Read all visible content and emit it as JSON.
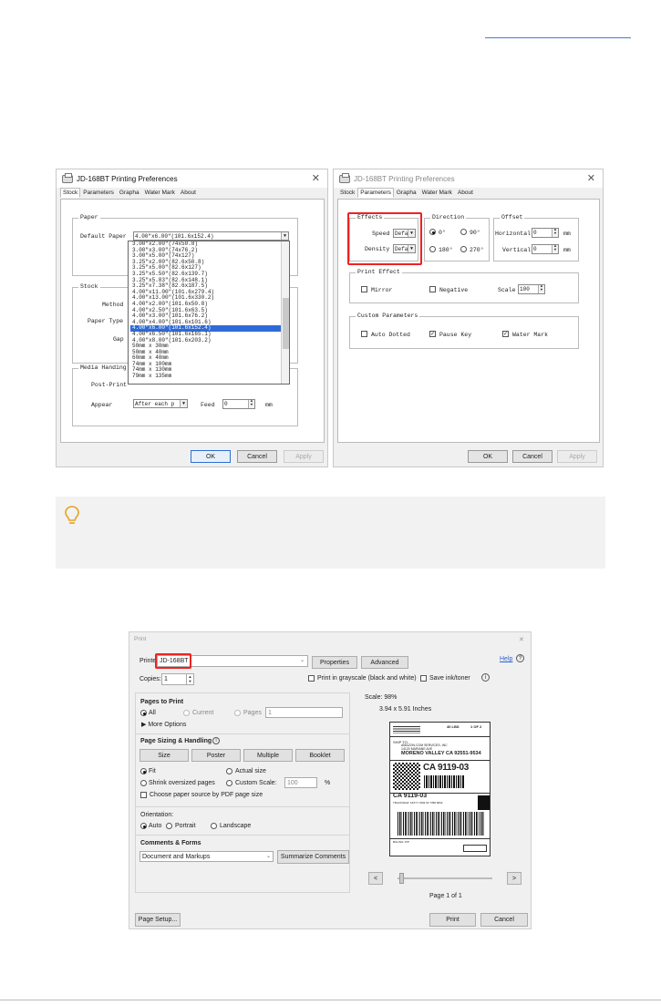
{
  "top_link": "",
  "stock_dialog": {
    "title": "JD-168BT Printing Preferences",
    "close": "✕",
    "tabs": [
      "Stock",
      "Parameters",
      "Grapha",
      "Water Mark",
      "About"
    ],
    "active_tab": "Stock",
    "paper_group": "Paper",
    "default_paper_label": "Default Paper",
    "default_paper_value": "4.00\"x6.00\"(101.6x152.4)",
    "paper_options": [
      "3.00\"x2.00\"(74x50.8)",
      "3.00\"x3.00\"(74x76.2)",
      "3.00\"x5.00\"(74x127)",
      "3.25\"x2.00\"(82.6x50.8)",
      "3.25\"x5.00\"(82.6x127)",
      "3.25\"x5.50\"(82.6x139.7)",
      "3.25\"x5.83\"(82.6x148.1)",
      "3.25\"x7.38\"(82.6x187.5)",
      "4.00\"x11.00\"(101.6x279.4)",
      "4.00\"x13.00\"(101.6x330.2)",
      "4.00\"x2.00\"(101.6x50.8)",
      "4.00\"x2.50\"(101.6x63.5)",
      "4.00\"x3.00\"(101.6x76.2)",
      "4.00\"x4.00\"(101.6x101.6)",
      "4.00\"x6.00\"(101.6x152.4)",
      "4.00\"x6.50\"(101.6x165.1)",
      "4.00\"x8.00\"(101.6x203.2)",
      "50mm x 30mm",
      "50mm x 40mm",
      "60mm x 40mm",
      "74mm x 100mm",
      "74mm x 130mm",
      "79mm x 135mm"
    ],
    "highlighted_option": 14,
    "stock_group": "Stock",
    "method_label": "Method",
    "paper_type_label": "Paper Type",
    "gap_label": "Gap",
    "media_group": "Media Handing",
    "post_print_label": "Post-Print",
    "appear_label": "Appear",
    "appear_value": "After each p",
    "feed_label": "Feed",
    "feed_value": "0",
    "feed_unit": "mm",
    "ok": "OK",
    "cancel": "Cancel",
    "apply": "Apply"
  },
  "param_dialog": {
    "title": "JD-168BT Printing Preferences",
    "close": "✕",
    "tabs": [
      "Stock",
      "Parameters",
      "Grapha",
      "Water Mark",
      "About"
    ],
    "active_tab": "Parameters",
    "effects_group": "Effects",
    "speed_label": "Speed",
    "speed_value": "Defa",
    "density_label": "Density",
    "density_value": "Defa",
    "direction_group": "Direction",
    "dir_0": "0°",
    "dir_90": "90°",
    "dir_180": "180°",
    "dir_270": "270°",
    "offset_group": "Offset",
    "horizontal_label": "Horizontal",
    "horizontal_value": "0",
    "vertical_label": "Vertical",
    "vertical_value": "0",
    "unit": "mm",
    "print_effect_group": "Print Effect",
    "mirror": "Mirror",
    "negative": "Negative",
    "scale_label": "Scale",
    "scale_value": "100",
    "custom_group": "Custom Parameters",
    "auto_dotted": "Auto Dotted",
    "pause_key": "Pause Key",
    "water_mark": "Water Mark",
    "ok": "OK",
    "cancel": "Cancel",
    "apply": "Apply"
  },
  "note_icon": "lightbulb-icon",
  "print_dialog": {
    "title": "Print",
    "close": "✕",
    "printer_label": "Printer:",
    "printer_value": "JD-168BT",
    "properties": "Properties",
    "advanced": "Advanced",
    "help": "Help",
    "copies_label": "Copies:",
    "copies_value": "1",
    "grayscale": "Print in grayscale (black and white)",
    "save_ink": "Save ink/toner",
    "pages_to_print": "Pages to Print",
    "all": "All",
    "current": "Current",
    "pages": "Pages",
    "pages_value": "1",
    "more_options": "More Options",
    "sizing_title": "Page Sizing & Handling",
    "size_btn": "Size",
    "poster_btn": "Poster",
    "multiple_btn": "Multiple",
    "booklet_btn": "Booklet",
    "fit": "Fit",
    "actual_size": "Actual size",
    "shrink": "Shrink oversized pages",
    "custom_scale": "Custom Scale:",
    "custom_scale_value": "100",
    "percent": "%",
    "choose_paper": "Choose paper source by PDF page size",
    "orientation": "Orientation:",
    "auto": "Auto",
    "portrait": "Portrait",
    "landscape": "Landscape",
    "comments_title": "Comments & Forms",
    "comments_value": "Document and Markups",
    "summarize": "Summarize Comments",
    "scale": "Scale: 98%",
    "dimensions": "3.94 x 5.91 Inches",
    "page_of": "Page 1 of 1",
    "page_setup": "Page Setup...",
    "print": "Print",
    "cancel": "Cancel",
    "label": {
      "ship_to": "SHIP TO:",
      "company": "AMAZON.COM SERVICES, INC",
      "street": "14120 MARIANE AVE",
      "city": "MORENO VALLEY CA 92551-9534",
      "weight": "40 LBS",
      "count": "1 OF 2",
      "code": "CA 9119-03",
      "code2": "CA 9119-03",
      "tracking": "TRACKING#: 1ZXYY W93 03 7358 6843",
      "billing": "BILLING: P/P"
    }
  }
}
